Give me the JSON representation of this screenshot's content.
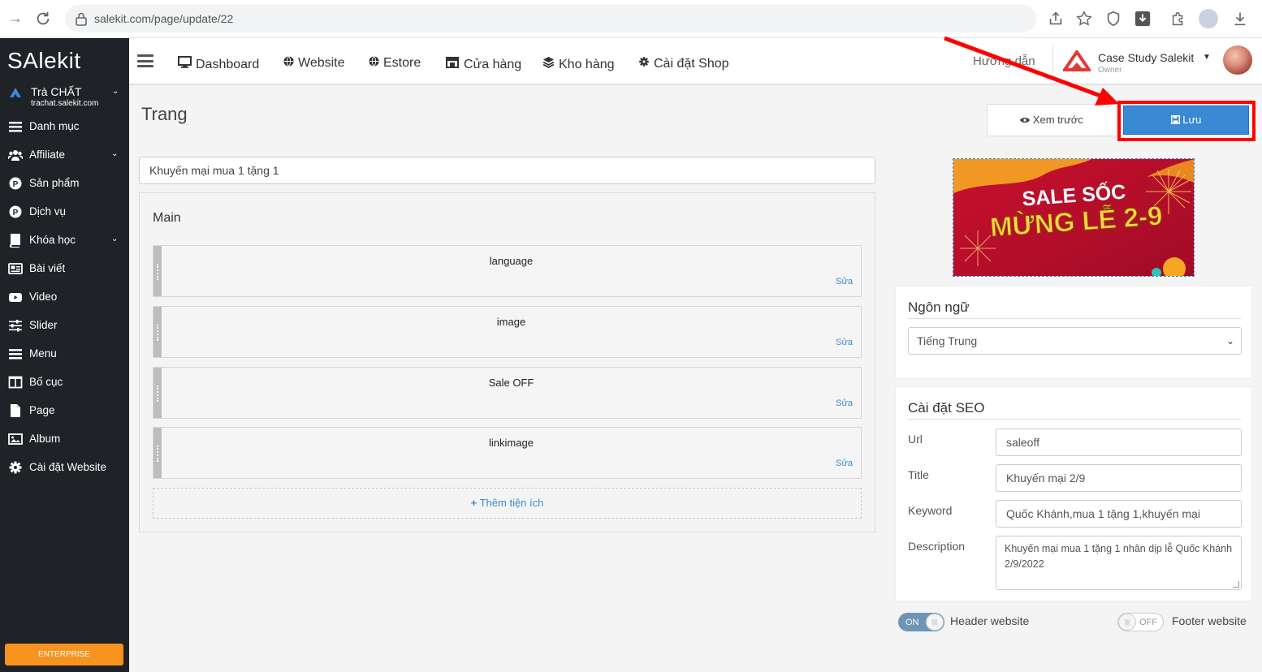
{
  "browser": {
    "url": "salekit.com/page/update/22"
  },
  "sidebar": {
    "logo": "SAlekit",
    "store_name": "Trà CHẤT",
    "store_domain": "trachat.salekit.com",
    "items": [
      {
        "label": "Danh mục",
        "icon": "list-icon",
        "expandable": false
      },
      {
        "label": "Affiliate",
        "icon": "users-icon",
        "expandable": true
      },
      {
        "label": "Sản phẩm",
        "icon": "product-icon",
        "expandable": false
      },
      {
        "label": "Dịch vụ",
        "icon": "service-icon",
        "expandable": false
      },
      {
        "label": "Khóa học",
        "icon": "book-icon",
        "expandable": true
      },
      {
        "label": "Bài viết",
        "icon": "newspaper-icon",
        "expandable": false
      },
      {
        "label": "Video",
        "icon": "video-icon",
        "expandable": false
      },
      {
        "label": "Slider",
        "icon": "sliders-icon",
        "expandable": false
      },
      {
        "label": "Menu",
        "icon": "menu-icon",
        "expandable": false
      },
      {
        "label": "Bố cục",
        "icon": "columns-icon",
        "expandable": false
      },
      {
        "label": "Page",
        "icon": "page-icon",
        "expandable": false
      },
      {
        "label": "Album",
        "icon": "image-icon",
        "expandable": false
      },
      {
        "label": "Cài đặt Website",
        "icon": "gear-icon",
        "expandable": false
      }
    ],
    "plan_badge": "ENTERPRISE"
  },
  "topnav": {
    "items": [
      {
        "label": "Dashboard",
        "icon": "desktop-icon"
      },
      {
        "label": "Website",
        "icon": "globe-icon"
      },
      {
        "label": "Estore",
        "icon": "globe-icon"
      },
      {
        "label": "Cửa hàng",
        "icon": "store-icon"
      },
      {
        "label": "Kho hàng",
        "icon": "layers-icon"
      },
      {
        "label": "Cài đặt Shop",
        "icon": "gear-icon"
      }
    ],
    "guide": "Hướng dẫn",
    "account_name": "Case Study Salekit",
    "account_role": "Owner"
  },
  "page": {
    "title": "Trang",
    "preview_label": "Xem trước",
    "save_label": "Lưu",
    "name_value": "Khuyến mại mua 1 tặng 1",
    "main_title": "Main",
    "widgets": [
      {
        "name": "language",
        "edit": "Sửa"
      },
      {
        "name": "image",
        "edit": "Sửa"
      },
      {
        "name": "Sale OFF",
        "edit": "Sửa"
      },
      {
        "name": "linkimage",
        "edit": "Sửa"
      }
    ],
    "add_widget": "Thêm tiện ích"
  },
  "banner": {
    "line1": "SALE SỐC",
    "line2": "MỪNG LỄ 2-9"
  },
  "language_card": {
    "title": "Ngôn ngữ",
    "selected": "Tiếng Trung"
  },
  "seo": {
    "title": "Cài đặt SEO",
    "url_label": "Url",
    "url_value": "saleoff",
    "title_label": "Title",
    "title_value": "Khuyến mại 2/9",
    "keyword_label": "Keyword",
    "keyword_value": "Quốc Khánh,mua 1 tặng 1,khuyến mại",
    "description_label": "Description",
    "description_value": "Khuyến mại mua 1 tặng 1 nhân dịp lễ Quốc Khánh 2/9/2022"
  },
  "toggles": {
    "header_state": "ON",
    "header_label": "Header website",
    "footer_state": "OFF",
    "footer_label": "Footer website"
  },
  "colors": {
    "sidebar_bg": "#1f2327",
    "primary": "#3a89d4",
    "highlight": "#ff0000",
    "enterprise": "#f7931e"
  }
}
